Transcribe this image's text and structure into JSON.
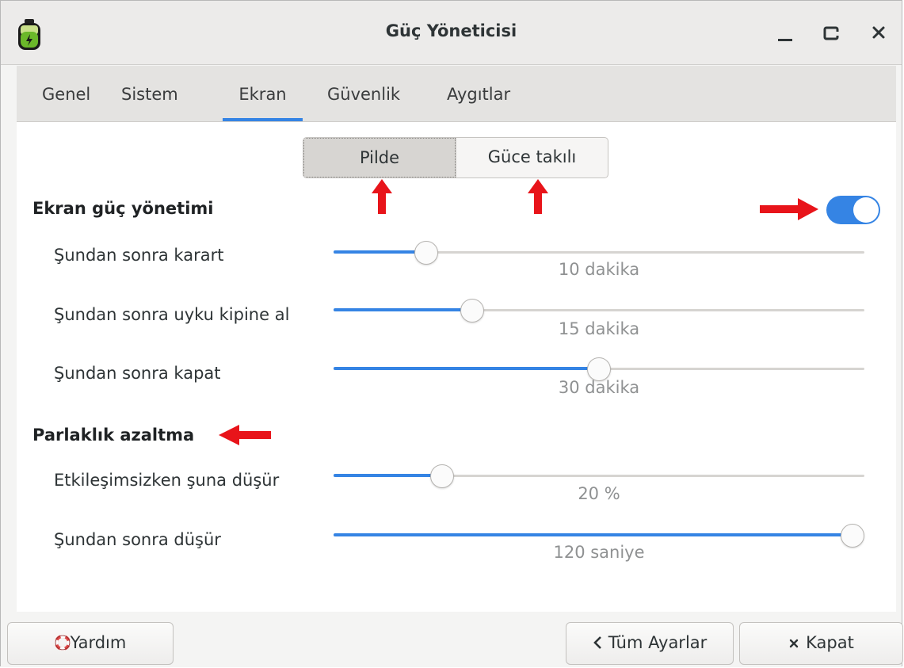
{
  "window": {
    "title": "Güç Yöneticisi"
  },
  "tabs": [
    {
      "label": "Genel"
    },
    {
      "label": "Sistem"
    },
    {
      "label": "Ekran",
      "active": true
    },
    {
      "label": "Güvenlik"
    },
    {
      "label": "Aygıtlar"
    }
  ],
  "power_source": {
    "options": [
      "Pilde",
      "Güce takılı"
    ],
    "selected": "Pilde"
  },
  "display_power": {
    "heading": "Ekran güç yönetimi",
    "enabled": true,
    "rows": [
      {
        "label": "Şundan sonra karart",
        "value_text": "10 dakika",
        "fraction": 0.16
      },
      {
        "label": "Şundan sonra uyku kipine al",
        "value_text": "15 dakika",
        "fraction": 0.25
      },
      {
        "label": "Şundan sonra kapat",
        "value_text": "30 dakika",
        "fraction": 0.5
      }
    ]
  },
  "brightness": {
    "heading": "Parlaklık azaltma",
    "rows": [
      {
        "label": "Etkileşimsizken şuna düşür",
        "value_text": "20 %",
        "fraction": 0.19
      },
      {
        "label": "Şundan sonra düşür",
        "value_text": "120 saniye",
        "fraction": 1.0
      }
    ]
  },
  "buttons": {
    "help": "Yardım",
    "all_settings": "Tüm Ayarlar",
    "close": "Kapat"
  },
  "colors": {
    "accent": "#3584e4",
    "annotation_arrow": "#e8141a"
  }
}
